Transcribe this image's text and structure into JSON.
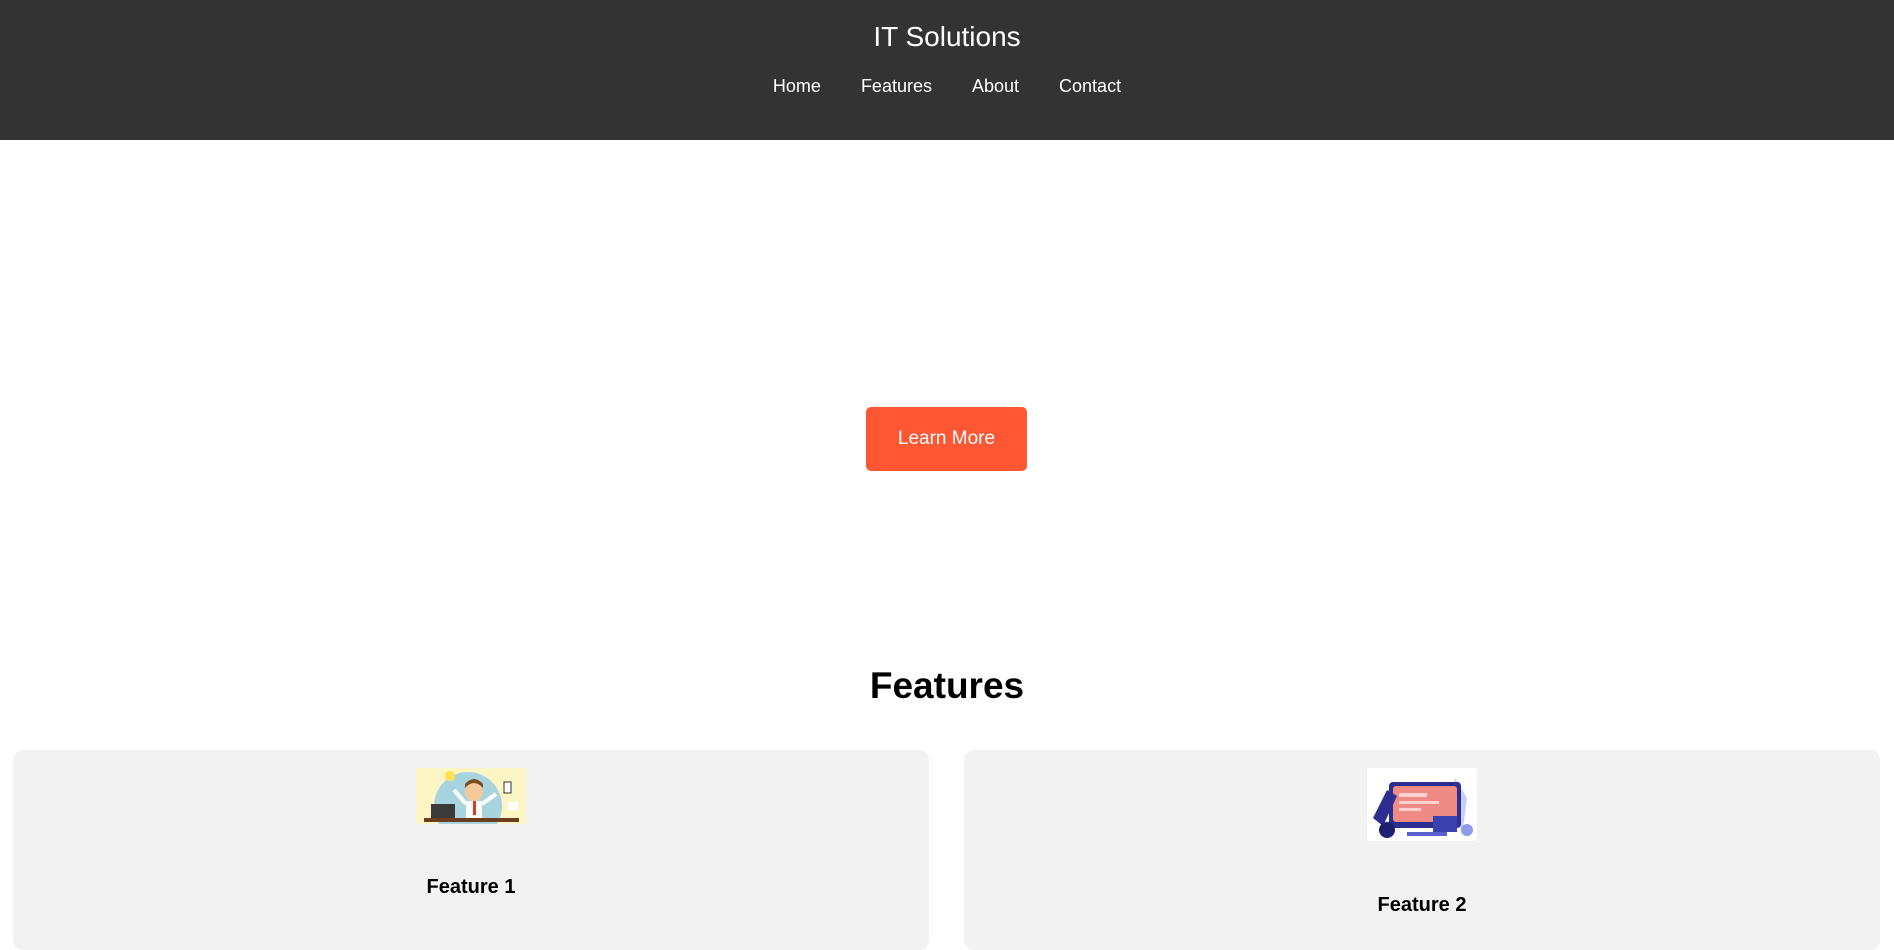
{
  "header": {
    "title": "IT Solutions",
    "nav": [
      "Home",
      "Features",
      "About",
      "Contact"
    ]
  },
  "hero": {
    "cta_label": "Learn More"
  },
  "features": {
    "heading": "Features",
    "cards": [
      {
        "title": "Feature 1",
        "image": "office-worker-illustration"
      },
      {
        "title": "Feature 2",
        "image": "computer-robot-arm-illustration"
      }
    ]
  },
  "colors": {
    "header_bg": "#333333",
    "accent": "#ff5733",
    "card_bg": "#f2f2f2"
  }
}
